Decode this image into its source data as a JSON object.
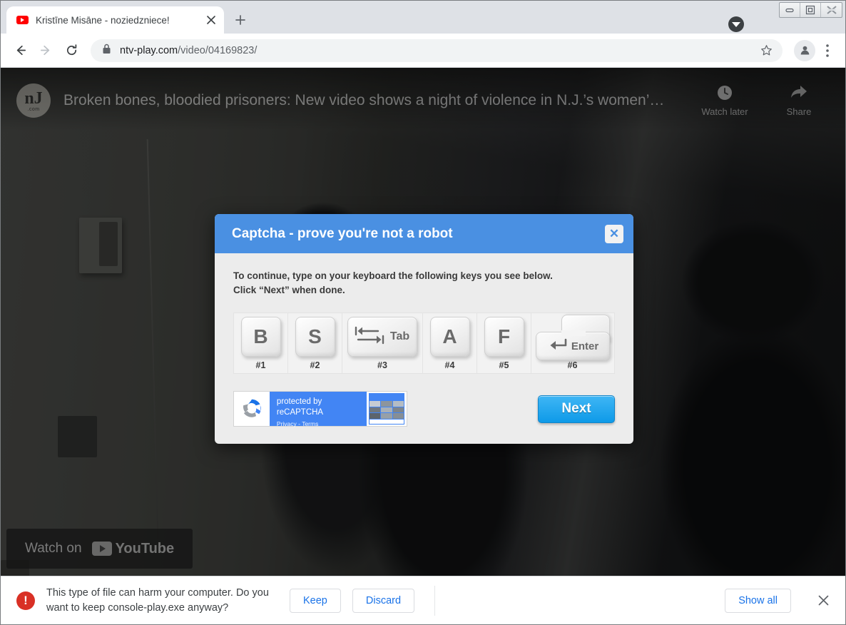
{
  "browser": {
    "tab": {
      "title": "Kristīne Misāne - noziedzniece!",
      "favicon": "youtube-icon",
      "close_label": "×"
    },
    "new_tab_label": "+",
    "window_controls": {
      "minimize": "minimize-icon",
      "maximize": "maximize-icon",
      "close": "close-icon"
    },
    "downloads_indicator": "download-arrow-icon",
    "toolbar": {
      "back": "back-arrow-icon",
      "forward": "forward-arrow-icon",
      "reload": "reload-icon",
      "lock": "lock-icon",
      "url_host": "ntv-play.com",
      "url_path": "/video/04169823/",
      "bookmark": "star-icon",
      "profile": "avatar-icon",
      "menu": "three-dot-menu-icon"
    }
  },
  "video": {
    "channel_avatar_main": "nJ",
    "channel_avatar_sub": ".com",
    "title": "Broken bones, bloodied prisoners: New video shows a night of violence in N.J.’s women’…",
    "actions": [
      {
        "icon": "clock-icon",
        "label": "Watch later"
      },
      {
        "icon": "share-arrow-icon",
        "label": "Share"
      }
    ],
    "watch_on_prefix": "Watch on",
    "watch_on_brand": "YouTube"
  },
  "modal": {
    "title": "Captcha - prove you're not a robot",
    "close_label": "✕",
    "instructions_line1": "To continue, type on your keyboard the following keys you see below.",
    "instructions_line2": "Click “Next” when done.",
    "keys": [
      {
        "cap": "B",
        "label": "#1",
        "kind": "letter"
      },
      {
        "cap": "S",
        "label": "#2",
        "kind": "letter"
      },
      {
        "cap": "Tab",
        "label": "#3",
        "kind": "tab"
      },
      {
        "cap": "A",
        "label": "#4",
        "kind": "letter"
      },
      {
        "cap": "F",
        "label": "#5",
        "kind": "letter"
      },
      {
        "cap": "Enter",
        "label": "#6",
        "kind": "enter"
      }
    ],
    "recaptcha": {
      "line1": "protected by reCAPTCHA",
      "line2": "Privacy - Terms",
      "logo": "recaptcha-logo-icon"
    },
    "next_label": "Next",
    "accent_color": "#4a90e2",
    "next_color": "#0e9ae8"
  },
  "download_bar": {
    "warning_icon": "exclamation-circle-icon",
    "message": "This type of file can harm your computer. Do you want to keep console-play.exe anyway?",
    "keep_label": "Keep",
    "discard_label": "Discard",
    "show_all_label": "Show all",
    "close_label": "✕",
    "warning_color": "#d93025",
    "link_color": "#1a73e8"
  }
}
